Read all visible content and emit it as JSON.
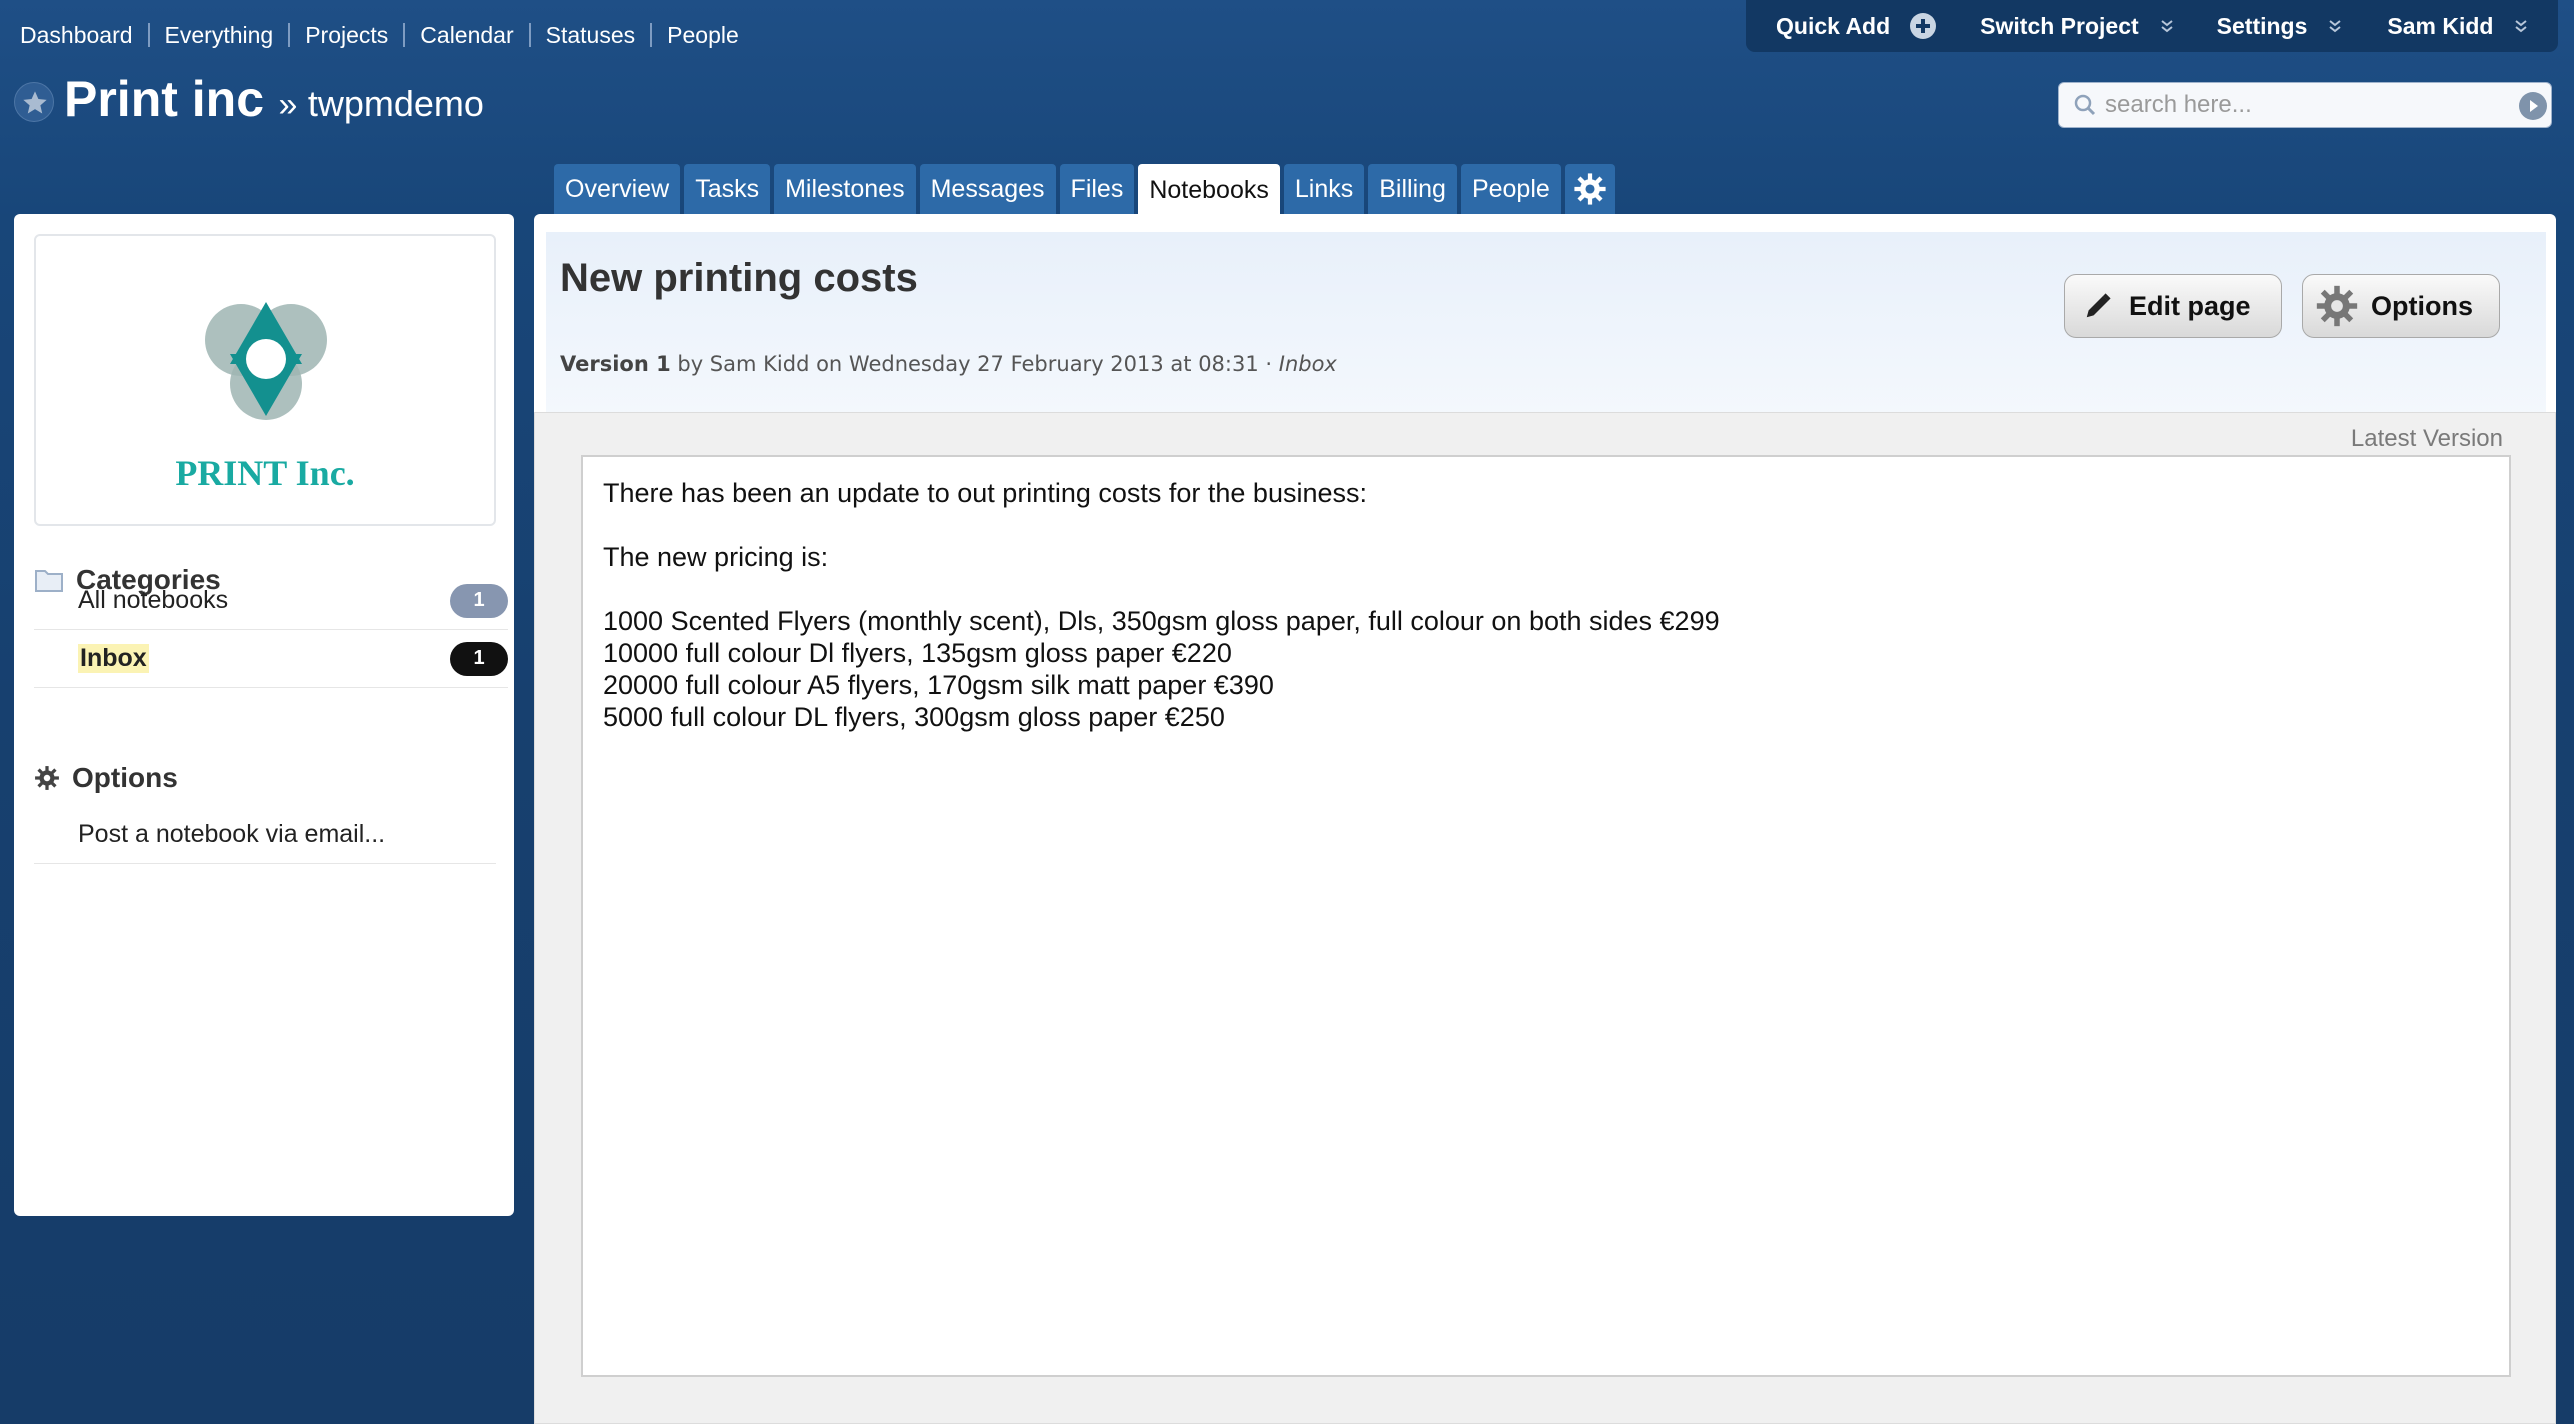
{
  "nav": {
    "links": [
      "Dashboard",
      "Everything",
      "Projects",
      "Calendar",
      "Statuses",
      "People"
    ]
  },
  "userbar": {
    "quick_add": "Quick Add",
    "switch_project": "Switch Project",
    "settings": "Settings",
    "user": "Sam Kidd"
  },
  "project": {
    "company": "Print inc",
    "separator": "»",
    "name": "twpmdemo"
  },
  "search": {
    "placeholder": "search here..."
  },
  "tabs": [
    "Overview",
    "Tasks",
    "Milestones",
    "Messages",
    "Files",
    "Notebooks",
    "Links",
    "Billing",
    "People"
  ],
  "active_tab": "Notebooks",
  "sidebar": {
    "logo_text": "PRINT Inc.",
    "categories_heading": "Categories",
    "categories": [
      {
        "label": "All notebooks",
        "count": "1"
      },
      {
        "label": "Inbox",
        "count": "1"
      }
    ],
    "options_heading": "Options",
    "options_items": [
      "Post a notebook via email..."
    ]
  },
  "page": {
    "title": "New printing costs",
    "version_label": "Version 1",
    "version_by": " by Sam Kidd on Wednesday 27 February 2013 at 08:31 · ",
    "version_category": "Inbox",
    "edit_button": "Edit page",
    "options_button": "Options",
    "latest_version": "Latest Version",
    "body": {
      "intro": "There has been an update to out printing costs for the business:",
      "pricing_heading": "The new pricing is:",
      "lines": [
        "1000 Scented Flyers (monthly scent), Dls, 350gsm gloss paper, full colour on both sides €299",
        "10000 full colour Dl flyers, 135gsm gloss paper €220",
        "20000 full colour A5 flyers, 170gsm silk matt paper €390",
        "5000 full colour DL flyers, 300gsm gloss paper €250"
      ]
    }
  },
  "colors": {
    "header_bg": "#1f4f86",
    "tab_bg": "#2d6aa8",
    "logo_teal": "#19aaa2",
    "highlight": "#fbf3b4"
  }
}
